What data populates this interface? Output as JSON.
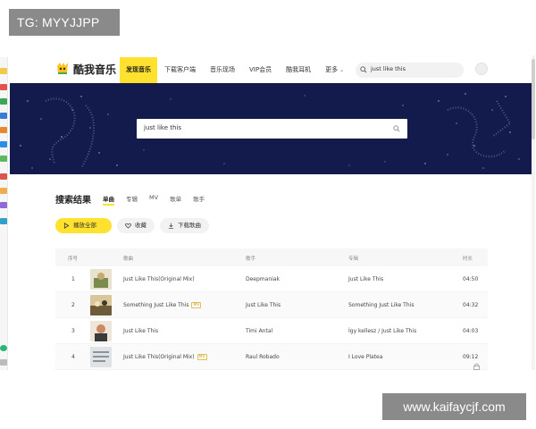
{
  "watermarks": {
    "top_left": "TG: MYYJJPP",
    "bottom_right": "www.kaifaycjf.com"
  },
  "app": {
    "name": "酷我音乐",
    "logo_icon": "kuwo-logo-icon"
  },
  "nav": {
    "items": [
      {
        "label": "发现音乐",
        "active": true
      },
      {
        "label": "下载客户端",
        "active": false
      },
      {
        "label": "音乐现场",
        "active": false
      },
      {
        "label": "VIP会员",
        "active": false
      },
      {
        "label": "酷我耳机",
        "active": false
      },
      {
        "label": "更多",
        "active": false,
        "dropdown": true
      }
    ]
  },
  "header_search": {
    "value": "just like this",
    "icon": "search-icon"
  },
  "banner_search": {
    "value": "just like this",
    "icon": "search-icon"
  },
  "results": {
    "title": "搜索结果",
    "tabs": [
      {
        "label": "单曲",
        "active": true
      },
      {
        "label": "专辑",
        "active": false
      },
      {
        "label": "MV",
        "active": false
      },
      {
        "label": "歌单",
        "active": false
      },
      {
        "label": "歌手",
        "active": false
      }
    ]
  },
  "actions": {
    "play_all": "播放全部",
    "favorite": "收藏",
    "download": "下载歌曲"
  },
  "table": {
    "headers": {
      "index": "序号",
      "song": "歌曲",
      "singer": "歌手",
      "album": "专辑",
      "duration": "时长"
    },
    "rows": [
      {
        "index": "1",
        "song": "Just Like This(Original Mix)",
        "mv": "",
        "singer": "Deepmaniak",
        "album": "Just Like This",
        "duration": "04:50"
      },
      {
        "index": "2",
        "song": "Something Just Like This",
        "mv": "MV",
        "singer": "Just Like This",
        "album": "Something Just Like This",
        "duration": "04:32"
      },
      {
        "index": "3",
        "song": "Just Like This",
        "mv": "",
        "singer": "Timi Antal",
        "album": "Így kellesz / Just Like This",
        "duration": "04:03"
      },
      {
        "index": "4",
        "song": "Just Like This(Original Mix)",
        "mv": "MV",
        "singer": "Raul Robado",
        "album": "I Love Platea",
        "duration": "09:12"
      }
    ]
  },
  "colors": {
    "accent": "#ffe12e",
    "banner": "#131a4c"
  }
}
